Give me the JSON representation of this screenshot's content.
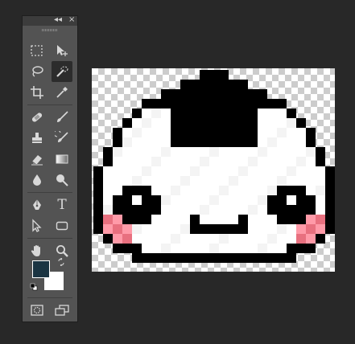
{
  "toolbar": {
    "collapse_glyph": "◂◂",
    "close_glyph": "×",
    "tools": [
      {
        "name": "marquee-tool-icon",
        "active": false
      },
      {
        "name": "move-tool-icon",
        "active": false
      },
      {
        "name": "lasso-tool-icon",
        "active": false
      },
      {
        "name": "quick-selection-tool-icon",
        "active": true
      },
      {
        "name": "crop-tool-icon",
        "active": false
      },
      {
        "name": "eyedropper-tool-icon",
        "active": false
      },
      {
        "name": "spot-healing-brush-icon",
        "active": false
      },
      {
        "name": "brush-tool-icon",
        "active": false
      },
      {
        "name": "clone-stamp-tool-icon",
        "active": false
      },
      {
        "name": "history-brush-icon",
        "active": false
      },
      {
        "name": "eraser-tool-icon",
        "active": false
      },
      {
        "name": "gradient-tool-icon",
        "active": false
      },
      {
        "name": "blur-tool-icon",
        "active": false
      },
      {
        "name": "dodge-tool-icon",
        "active": false
      },
      {
        "name": "pen-tool-icon",
        "active": false
      },
      {
        "name": "type-tool-icon",
        "active": false
      },
      {
        "name": "path-selection-tool-icon",
        "active": false
      },
      {
        "name": "shape-tool-icon",
        "active": false
      },
      {
        "name": "hand-tool-icon",
        "active": false
      },
      {
        "name": "zoom-tool-icon",
        "active": false
      },
      {
        "name": "quick-mask-icon",
        "active": false
      },
      {
        "name": "screen-mode-icon",
        "active": false
      }
    ],
    "type_glyph": "T",
    "foreground_color": "#1b3442",
    "background_color": "#ffffff"
  },
  "canvas": {
    "checker_light": "#ffffff",
    "checker_dark": "#cccccc",
    "art_colors": {
      "outline": "#000000",
      "fill": "#ffffff",
      "fill_alt": "#f4f4f4",
      "blush": "#ff9aa8",
      "blush_dark": "#e8707f",
      "eye_shine": "#ffffff"
    }
  }
}
